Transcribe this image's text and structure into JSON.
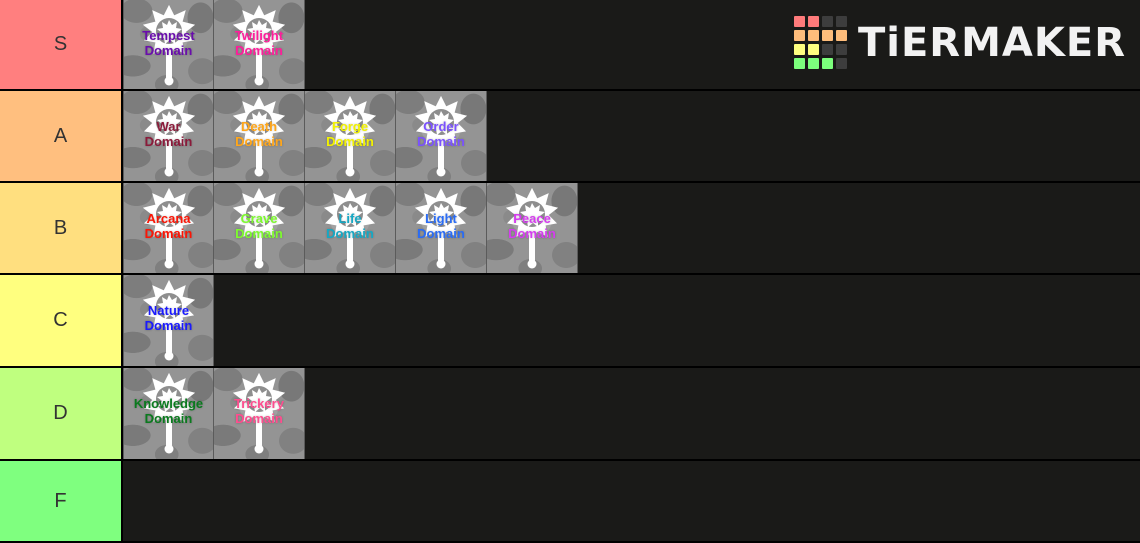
{
  "app": {
    "name": "TierMaker",
    "watermark_text": "TiERMAKER",
    "background_color": "#1a1a18"
  },
  "watermark_grid": {
    "colors": [
      "#ff7b7b",
      "#ff7b7b",
      "#3d3d3d",
      "#3d3d3d",
      "#ffbd7b",
      "#ffbd7b",
      "#ffbd7b",
      "#ffbd7b",
      "#ffff80",
      "#ffff80",
      "#3d3d3d",
      "#3d3d3d",
      "#7cff7c",
      "#7cff7c",
      "#7cff7c",
      "#3d3d3d"
    ]
  },
  "tiers": [
    {
      "label": "S",
      "color": "#ff7f7f",
      "items": [
        {
          "name": "Tempest Domain",
          "line1": "Tempest",
          "line2": "Domain",
          "text_color": "#6a0dad",
          "icon": "mace-icon"
        },
        {
          "name": "Twilight Domain",
          "line1": "Twilight",
          "line2": "Domain",
          "text_color": "#ff1d9b",
          "icon": "mace-icon"
        }
      ]
    },
    {
      "label": "A",
      "color": "#ffbf7f",
      "items": [
        {
          "name": "War Domain",
          "line1": "War",
          "line2": "Domain",
          "text_color": "#8b1a3a",
          "icon": "mace-icon"
        },
        {
          "name": "Death Domain",
          "line1": "Death",
          "line2": "Domain",
          "text_color": "#ffa61a",
          "icon": "mace-icon"
        },
        {
          "name": "Forge Domain",
          "line1": "Forge",
          "line2": "Domain",
          "text_color": "#f2f200",
          "icon": "mace-icon"
        },
        {
          "name": "Order Domain",
          "line1": "Order",
          "line2": "Domain",
          "text_color": "#7b52ff",
          "icon": "mace-icon"
        }
      ]
    },
    {
      "label": "B",
      "color": "#ffdf7f",
      "items": [
        {
          "name": "Arcana Domain",
          "line1": "Arcana",
          "line2": "Domain",
          "text_color": "#fc1505",
          "icon": "mace-icon"
        },
        {
          "name": "Grave Domain",
          "line1": "Grave",
          "line2": "Domain",
          "text_color": "#7dfa2e",
          "icon": "mace-icon"
        },
        {
          "name": "Life Domain",
          "line1": "Life",
          "line2": "Domain",
          "text_color": "#15a8c4",
          "icon": "mace-icon"
        },
        {
          "name": "Light Domain",
          "line1": "Light",
          "line2": "Domain",
          "text_color": "#2a6cf5",
          "icon": "mace-icon"
        },
        {
          "name": "Peace Domain",
          "line1": "Peace",
          "line2": "Domain",
          "text_color": "#d63cf0",
          "icon": "mace-icon"
        }
      ]
    },
    {
      "label": "C",
      "color": "#ffff7f",
      "items": [
        {
          "name": "Nature Domain",
          "line1": "Nature",
          "line2": "Domain",
          "text_color": "#1a1aff",
          "icon": "mace-icon"
        }
      ]
    },
    {
      "label": "D",
      "color": "#bfff7f",
      "items": [
        {
          "name": "Knowledge Domain",
          "line1": "Knowledge",
          "line2": "Domain",
          "text_color": "#0a7a1e",
          "icon": "mace-icon"
        },
        {
          "name": "Trickery Domain",
          "line1": "Trickery",
          "line2": "Domain",
          "text_color": "#ff4d8f",
          "icon": "mace-icon"
        }
      ]
    },
    {
      "label": "F",
      "color": "#7fff7f",
      "items": []
    }
  ]
}
